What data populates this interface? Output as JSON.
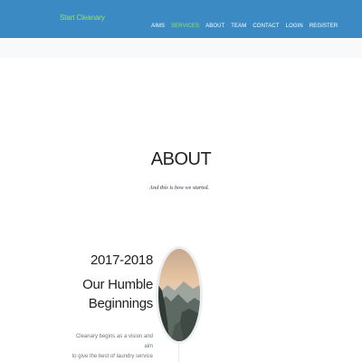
{
  "navbar": {
    "brand": "Start Cleanary",
    "items": [
      {
        "label": "AIMS",
        "active": false
      },
      {
        "label": "SERVICES",
        "active": true
      },
      {
        "label": "ABOUT",
        "active": false
      },
      {
        "label": "TEAM",
        "active": false
      },
      {
        "label": "CONTACT",
        "active": false
      },
      {
        "label": "LOGIN",
        "active": false
      },
      {
        "label": "REGISTER",
        "active": false
      }
    ]
  },
  "colors": {
    "navbar_bg": "#3c8ac4",
    "accent": "#8fe36b"
  },
  "about": {
    "heading": "ABOUT",
    "subheading": "And this is how we started."
  },
  "timeline": [
    {
      "date": "2017-2018",
      "title_line1": "Our Humble",
      "title_line2": "Beginnings",
      "body_line1": "Cleanary begins as a vision and aim",
      "body_line2": "to give the best of laundry service",
      "image": "mountain-landscape-photo"
    }
  ]
}
